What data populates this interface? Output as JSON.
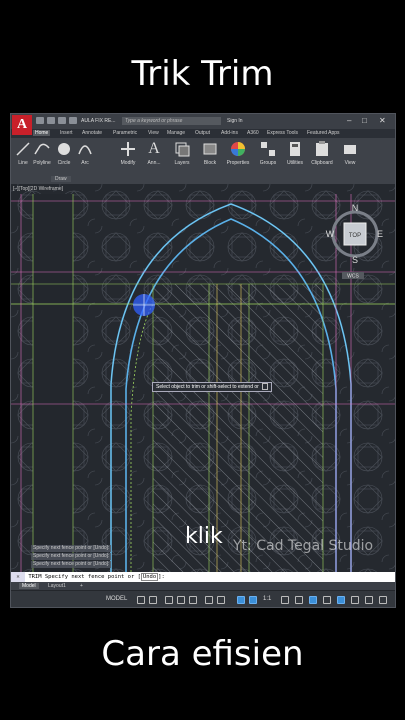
{
  "captions": {
    "top": "Trik Trim",
    "bottom": "Cara efisien"
  },
  "app": {
    "logo": "A",
    "doc_title": "AULA FIX RE...",
    "search_placeholder": "Type a keyword or phrase",
    "signin": "Sign In",
    "window_controls": [
      "–",
      "□",
      "✕"
    ]
  },
  "menu_tabs": [
    "Home",
    "Insert",
    "Annotate",
    "Parametric",
    "View",
    "Manage",
    "Output",
    "Add-ins",
    "A360",
    "Express Tools",
    "Featured Apps"
  ],
  "active_tab": "Home",
  "ribbon": {
    "tools": [
      "Line",
      "Polyline",
      "Circle",
      "Arc",
      "Modify",
      "Ann...",
      "Layers",
      "Block",
      "Properties",
      "Groups",
      "Utilities",
      "Clipboard",
      "View"
    ],
    "draw_panel": "Draw"
  },
  "viewport": {
    "label": "[–][Top][2D Wireframe]",
    "viewcube": {
      "n": "N",
      "s": "S",
      "e": "E",
      "w": "W",
      "top": "TOP",
      "wcs": "WCS"
    },
    "tooltip": "Select object to trim or shift-select to extend or",
    "history": [
      "Specify next fence point or [Undo]:",
      "Specify next fence point or [Undo]:",
      "Specify next fence point or [Undo]:"
    ]
  },
  "overlay": {
    "klik": "klik",
    "watermark": "Yt: Cad Tegal Studio"
  },
  "command_line": {
    "prefix": "TRIM",
    "text": "Specify next fence point or",
    "option": "Undo",
    "suffix": "]:"
  },
  "layout_tabs": [
    "Model",
    "Layout1",
    "+"
  ],
  "status": {
    "model_label": "MODEL",
    "scale": "1:1"
  },
  "colors": {
    "accent_blue": "#3b8fd8",
    "cyan_line": "#7fd3f0",
    "green_line": "#a0d860",
    "magenta_line": "#e070c0",
    "cursor": "#3060ff"
  }
}
